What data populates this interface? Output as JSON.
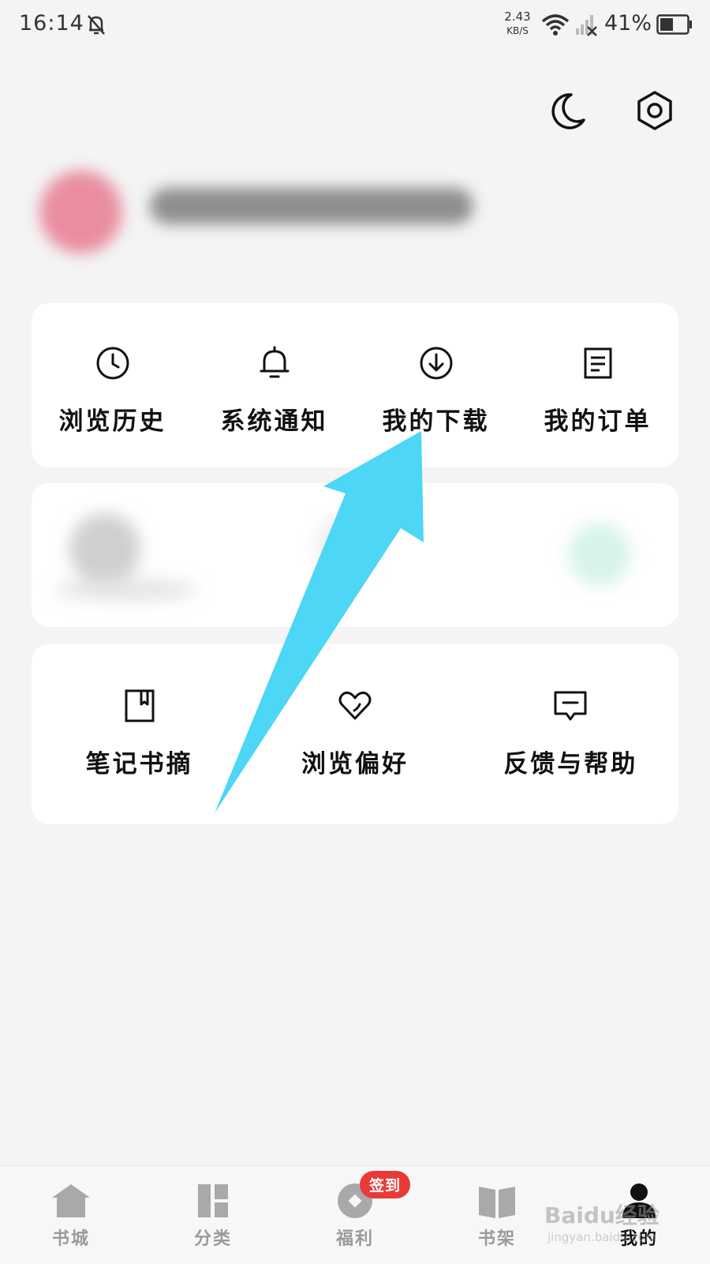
{
  "status_bar": {
    "time": "16:14",
    "net_speed_value": "2.43",
    "net_speed_unit": "KB/S",
    "battery": "41%"
  },
  "header_icons": [
    "moon-icon",
    "settings-icon"
  ],
  "menu_primary": [
    {
      "label": "浏览历史",
      "icon": "clock-icon"
    },
    {
      "label": "系统通知",
      "icon": "bell-icon"
    },
    {
      "label": "我的下载",
      "icon": "download-icon"
    },
    {
      "label": "我的订单",
      "icon": "order-icon"
    }
  ],
  "menu_secondary": [
    {
      "label": "笔记书摘",
      "icon": "bookmark-icon"
    },
    {
      "label": "浏览偏好",
      "icon": "heart-icon"
    },
    {
      "label": "反馈与帮助",
      "icon": "feedback-icon"
    }
  ],
  "bottom_nav": [
    {
      "label": "书城",
      "icon": "home-icon"
    },
    {
      "label": "分类",
      "icon": "category-icon"
    },
    {
      "label": "福利",
      "icon": "coin-icon",
      "badge": "签到"
    },
    {
      "label": "书架",
      "icon": "book-icon"
    },
    {
      "label": "我的",
      "icon": "user-icon",
      "active": true
    }
  ],
  "watermark": {
    "main": "Baidu经验",
    "sub": "jingyan.baidu.com"
  },
  "colors": {
    "arrow": "#4dd6f6",
    "badge": "#e93a3a",
    "background": "#f4f4f4"
  }
}
